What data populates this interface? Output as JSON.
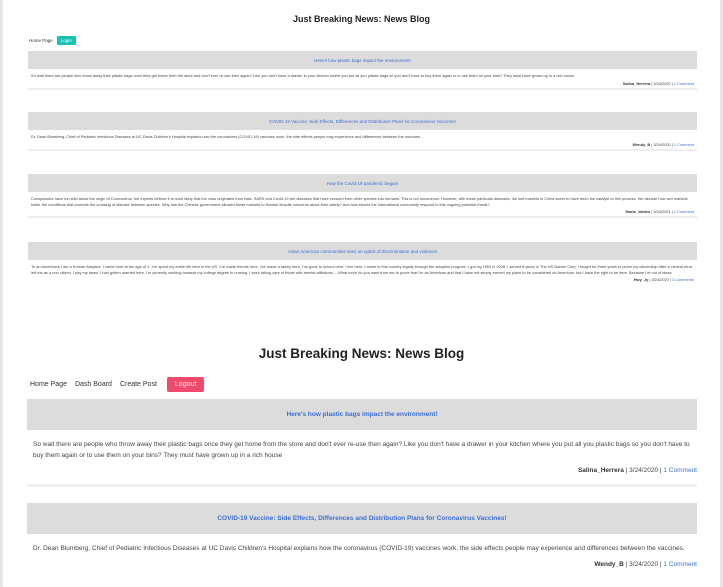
{
  "small": {
    "title": "Just Breaking News: News Blog",
    "nav": {
      "home": "Home Page",
      "login": "Login"
    },
    "posts": [
      {
        "title": "Here's how plastic bags impact the environment!",
        "body": "So wait there are people who throw away their plastic bags once they get home from the store and don't ever re-use then again? Like you don't have a drawer in your kitchen where you put all you plastic bags so you don't have to buy them again or to use them on your bins? They must have grown up in a rich house",
        "author": "Salina_Herrera",
        "date": "3/24/2020",
        "comments": "1 Comment"
      },
      {
        "title": "COVID-19 Vaccine: Side Effects, Differences and Distribution Plans for Coronavirus Vaccines!",
        "body": "Dr. Dean Blumberg, Chief of Pediatric Infectious Diseases at UC Davis Children's Hospital explains how the coronavirus (COVID-19) vaccines work, the side effects people may experience and differences between the vaccines.",
        "author": "Wendy_B",
        "date": "3/24/2020",
        "comments": "1 Comment"
      },
      {
        "title": "How the Covid-19 pandemic began!",
        "body": "Conspiracies have run wild about the origin of Coronavirus, but experts believe it is most likely that the virus originated from bats. SARS and Covid-19 are diseases that have crossed from other species into humans. This is not uncommon. However, with these particular diseases, the wet markets in China seem to have been the catalyst to this process. We decode how wet markets foster the conditions that promote the crossing of disease between species. Why has the Chinese government allowed these markets to flourish despite concerns about their safety? And how should the international community respond to this ongoing potential threat?",
        "author": "Maria_Valdes",
        "date": "3/24/2021",
        "comments": "1 Comment"
      },
      {
        "title": "Asian American communities sees an uptick of discrimination and violence!",
        "body": "To an Americans I am a Korean Adoptee. I came here at the age of 1. I've spent my entire life here in the US. I've made friends here, I've made a family here, I've gone to school here, I live here. I came to this country legally through the adoption program. I got my HSD in 2006. I served 8 years in The US Marine Corp, I fought for three years to prove my citizenship after a clerical error left me as a non citizen. I pay my taxes. I had gotten married here, I'm currently working towards my college degree in nursing. I work taking care of those with mental afflictions.....What more do you want from me to prove that I'm an American and that I have not simply earned my place to be considered an American, but I have the right to be here. Because I'm out of ideas",
        "author": "Hwy_Jy",
        "date": "3/24/2020",
        "comments": "3 Comments"
      }
    ]
  },
  "large": {
    "title": "Just Breaking News: News Blog",
    "nav": {
      "home": "Home Page",
      "dashboard": "Dash Board",
      "create": "Create Post",
      "logout": "Logout"
    },
    "posts": [
      {
        "title": "Here's how plastic bags impact the environment!",
        "body": "So wait there are people who throw away their plastic bags once they get home from the store and don't ever re-use then again? Like you don't have a drawer in your kitchen where you put all you plastic bags so you don't have to buy them again or to use them on your bins? They must have grown up in a rich house",
        "author": "Salina_Herrera",
        "date": "3/24/2020",
        "comments": "1 Comment"
      },
      {
        "title": "COVID-19 Vaccine: Side Effects, Differences and Distribution Plans for Coronavirus Vaccines!",
        "body": "Dr. Dean Blumberg, Chief of Pediatric Infectious Diseases at UC Davis Children's Hospital explains how the coronavirus (COVID-19) vaccines work, the side effects people may experience and differences between the vaccines.",
        "author": "Wendy_B",
        "date": "3/24/2020",
        "comments": "1 Comment"
      }
    ]
  },
  "colors": {
    "accent_link": "#3b6fd6",
    "login_button": "#17c3b2",
    "logout_button": "#ef4a6b",
    "post_header": "#dcdcdc"
  }
}
